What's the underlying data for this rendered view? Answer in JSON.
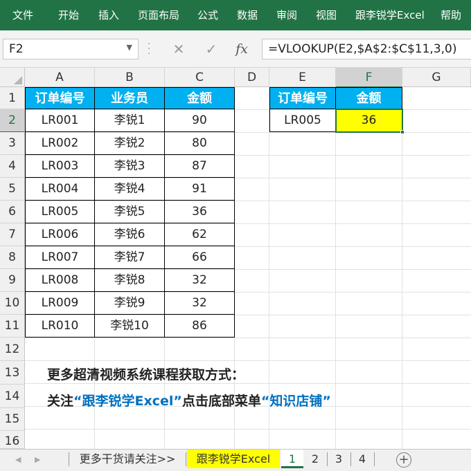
{
  "ribbon": {
    "tabs": [
      "文件",
      "开始",
      "插入",
      "页面布局",
      "公式",
      "数据",
      "审阅",
      "视图",
      "跟李锐学Excel",
      "帮助"
    ],
    "bg_color": "#217346"
  },
  "formula_bar": {
    "name_box": "F2",
    "cancel_icon": "✕",
    "enter_icon": "✓",
    "fx_label": "fx",
    "formula": "=VLOOKUP(E2,$A$2:$C$11,3,0)"
  },
  "columns": [
    "A",
    "B",
    "C",
    "D",
    "E",
    "F",
    "G"
  ],
  "rows": [
    "1",
    "2",
    "3",
    "4",
    "5",
    "6",
    "7",
    "8",
    "9",
    "10",
    "11",
    "12",
    "13",
    "14",
    "15",
    "16"
  ],
  "table1": {
    "headers": [
      "订单编号",
      "业务员",
      "金额"
    ],
    "rows": [
      [
        "LR001",
        "李锐1",
        "90"
      ],
      [
        "LR002",
        "李锐2",
        "80"
      ],
      [
        "LR003",
        "李锐3",
        "87"
      ],
      [
        "LR004",
        "李锐4",
        "91"
      ],
      [
        "LR005",
        "李锐5",
        "36"
      ],
      [
        "LR006",
        "李锐6",
        "62"
      ],
      [
        "LR007",
        "李锐7",
        "66"
      ],
      [
        "LR008",
        "李锐8",
        "32"
      ],
      [
        "LR009",
        "李锐9",
        "32"
      ],
      [
        "LR010",
        "李锐10",
        "86"
      ]
    ],
    "header_color": "#00b0f0"
  },
  "table2": {
    "headers": [
      "订单编号",
      "金额"
    ],
    "lookup_value": "LR005",
    "result": "36",
    "result_color": "#ffff00"
  },
  "notes": {
    "line1": "更多超清视频系统课程获取方式：",
    "line2_a": "关注",
    "line2_b": "“跟李锐学Excel”",
    "line2_c": "点击底部菜单",
    "line2_d": "“知识店铺”"
  },
  "sheet_tabs": {
    "tabs": [
      "更多干货请关注>>",
      "跟李锐学Excel",
      "1",
      "2",
      "3",
      "4"
    ],
    "active": "1",
    "add_icon": "+"
  }
}
